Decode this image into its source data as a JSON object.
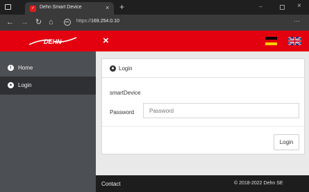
{
  "browser": {
    "tab_title": "Dehn Smart Device",
    "tab_close": "×",
    "new_tab": "+",
    "url_prefix": "https://",
    "url_host": "169.254.0.10",
    "menu": "···",
    "window_min": "–",
    "window_close": "×"
  },
  "header": {
    "logo_text": "DEHN",
    "close_glyph": "×",
    "languages": [
      "de",
      "en"
    ],
    "brand_color": "#e3000f"
  },
  "sidebar": {
    "items": [
      {
        "label": "Home",
        "icon": "info-icon"
      },
      {
        "label": "Login",
        "icon": "user-icon",
        "active": true
      }
    ]
  },
  "login_card": {
    "title": "Login",
    "device_label": "smartDevice",
    "password_label": "Password",
    "password_placeholder": "Password",
    "password_value": "",
    "submit_label": "Login"
  },
  "footer": {
    "contact": "Contact",
    "copyright": "© 2018-2022 Dehn SE"
  }
}
